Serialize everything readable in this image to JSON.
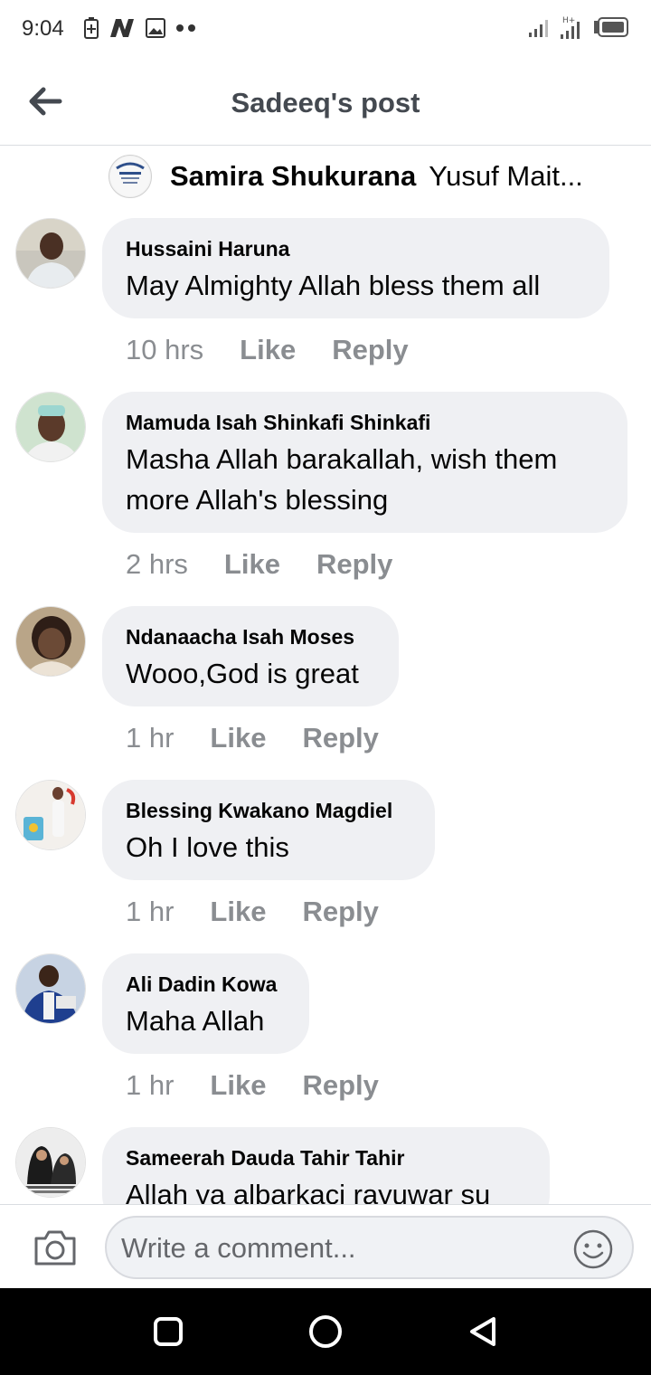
{
  "status_bar": {
    "time": "9:04"
  },
  "header": {
    "title": "Sadeeq's post"
  },
  "reply_context": {
    "name": "Samira Shukurana",
    "text": "Yusuf Mait..."
  },
  "comments": [
    {
      "author": "Hussaini Haruna",
      "text": "May Almighty Allah bless them all",
      "time": "10 hrs",
      "like": "Like",
      "reply": "Reply"
    },
    {
      "author": "Mamuda Isah Shinkafi Shinkafi",
      "text": "Masha Allah barakallah, wish them more Allah's blessing",
      "time": "2 hrs",
      "like": "Like",
      "reply": "Reply"
    },
    {
      "author": "Ndanaacha Isah Moses",
      "text": "Wooo,God is great",
      "time": "1 hr",
      "like": "Like",
      "reply": "Reply"
    },
    {
      "author": "Blessing Kwakano Magdiel",
      "text": "Oh I love this",
      "time": "1 hr",
      "like": "Like",
      "reply": "Reply"
    },
    {
      "author": "Ali Dadin Kowa",
      "text": "Maha Allah",
      "time": "1 hr",
      "like": "Like",
      "reply": "Reply"
    },
    {
      "author": "Sameerah Dauda Tahir Tahir",
      "text": "Allah ya albarkaci rayuwar su"
    }
  ],
  "composer": {
    "placeholder": "Write a comment..."
  }
}
